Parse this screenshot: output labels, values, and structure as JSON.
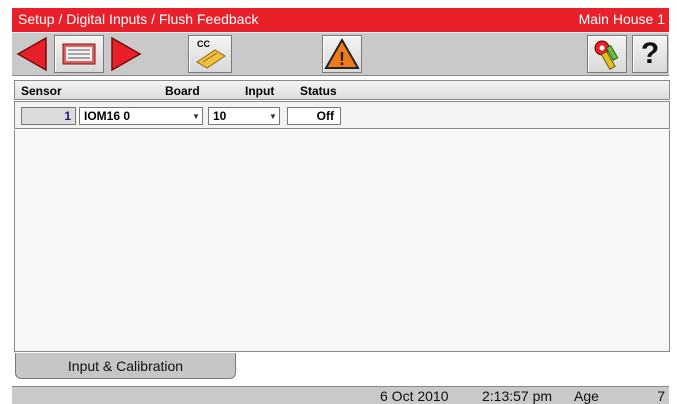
{
  "title_bar": {
    "breadcrumb": "Setup / Digital Inputs / Flush Feedback",
    "location": "Main House 1"
  },
  "toolbar": {
    "cc_label": "CC",
    "warning_symbol": "!",
    "help_symbol": "?"
  },
  "colors": {
    "title_red": "#e8202a",
    "arrow_red": "#e8202a",
    "warning_orange": "#f07a1a"
  },
  "table": {
    "columns": [
      "Sensor",
      "Board",
      "Input",
      "Status"
    ],
    "rows": [
      {
        "sensor": "1",
        "board": "IOM16 0",
        "input": "10",
        "status": "Off"
      }
    ]
  },
  "tabs": [
    {
      "label": "Input & Calibration"
    }
  ],
  "status_bar": {
    "date": "6 Oct 2010",
    "time": "2:13:57 pm",
    "age_label": "Age",
    "age_value": "7"
  }
}
